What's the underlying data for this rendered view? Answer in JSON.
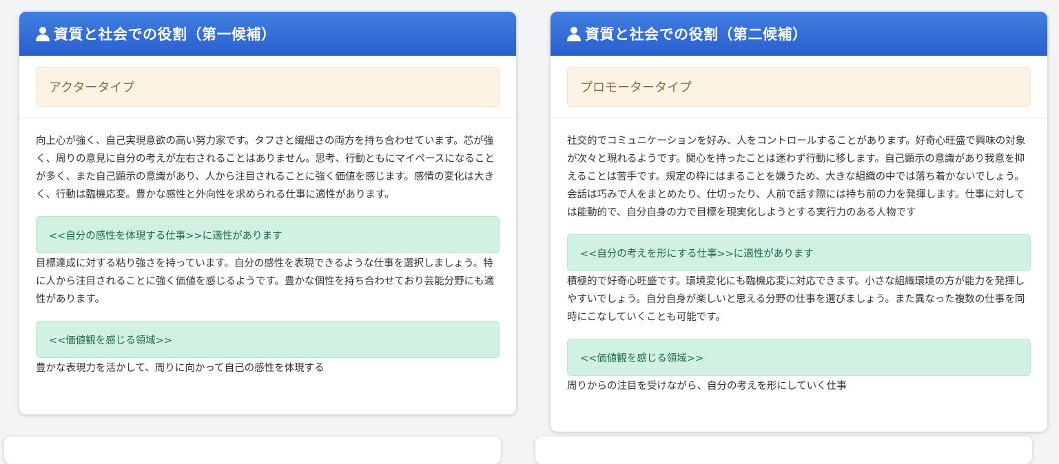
{
  "cards": [
    {
      "title": "資質と社会での役割（第一候補）",
      "type_name": "アクタータイプ",
      "description": "向上心が強く、自己実現意欲の高い努力家です。タフさと繊細さの両方を持ち合わせています。芯が強く、周りの意見に自分の考えが左右されることはありません。思考、行動ともにマイペースになることが多く、また自己顕示の意識があり、人から注目されることに強く価値を感じます。感情の変化は大きく、行動は臨機応変。豊かな感性と外向性を求められる仕事に適性があります。",
      "suitability_label": "<<自分の感性を体現する仕事>>に適性があります",
      "suitability_text": "目標達成に対する粘り強さを持っています。自分の感性を表現できるような仕事を選択しましょう。特に人から注目されることに強く価値を感じるようです。豊かな個性を持ち合わせており芸能分野にも適性があります。",
      "value_label": "<<価値観を感じる領域>>",
      "value_text": "豊かな表現力を活かして、周りに向かって自己の感性を体現する"
    },
    {
      "title": "資質と社会での役割（第二候補）",
      "type_name": "プロモータータイプ",
      "description": "社交的でコミュニケーションを好み、人をコントロールすることがあります。好奇心旺盛で興味の対象が次々と現れるようです。関心を持ったことは迷わず行動に移します。自己顕示の意識があり我意を抑えることは苦手です。規定の枠にはまることを嫌うため、大きな組織の中では落ち着かないでしょう。会話は巧みで人をまとめたり、仕切ったり、人前で話す際には持ち前の力を発揮します。仕事に対しては能動的で、自分自身の力で目標を現実化しようとする実行力のある人物です",
      "suitability_label": "<<自分の考えを形にする仕事>>に適性があります",
      "suitability_text": "積極的で好奇心旺盛です。環境変化にも臨機応変に対応できます。小さな組織環境の方が能力を発揮しやすいでしょう。自分自身が楽しいと思える分野の仕事を選びましょう。また異なった複数の仕事を同時にこなしていくことも可能です。",
      "value_label": "<<価値観を感じる領域>>",
      "value_text": "周りからの注目を受けながら、自分の考えを形にしていく仕事"
    }
  ],
  "colors": {
    "header": "#2b5fcf",
    "type_box": "#fdf3e5",
    "alert": "#d1f1e3"
  },
  "icons": {
    "header": "person-icon"
  }
}
